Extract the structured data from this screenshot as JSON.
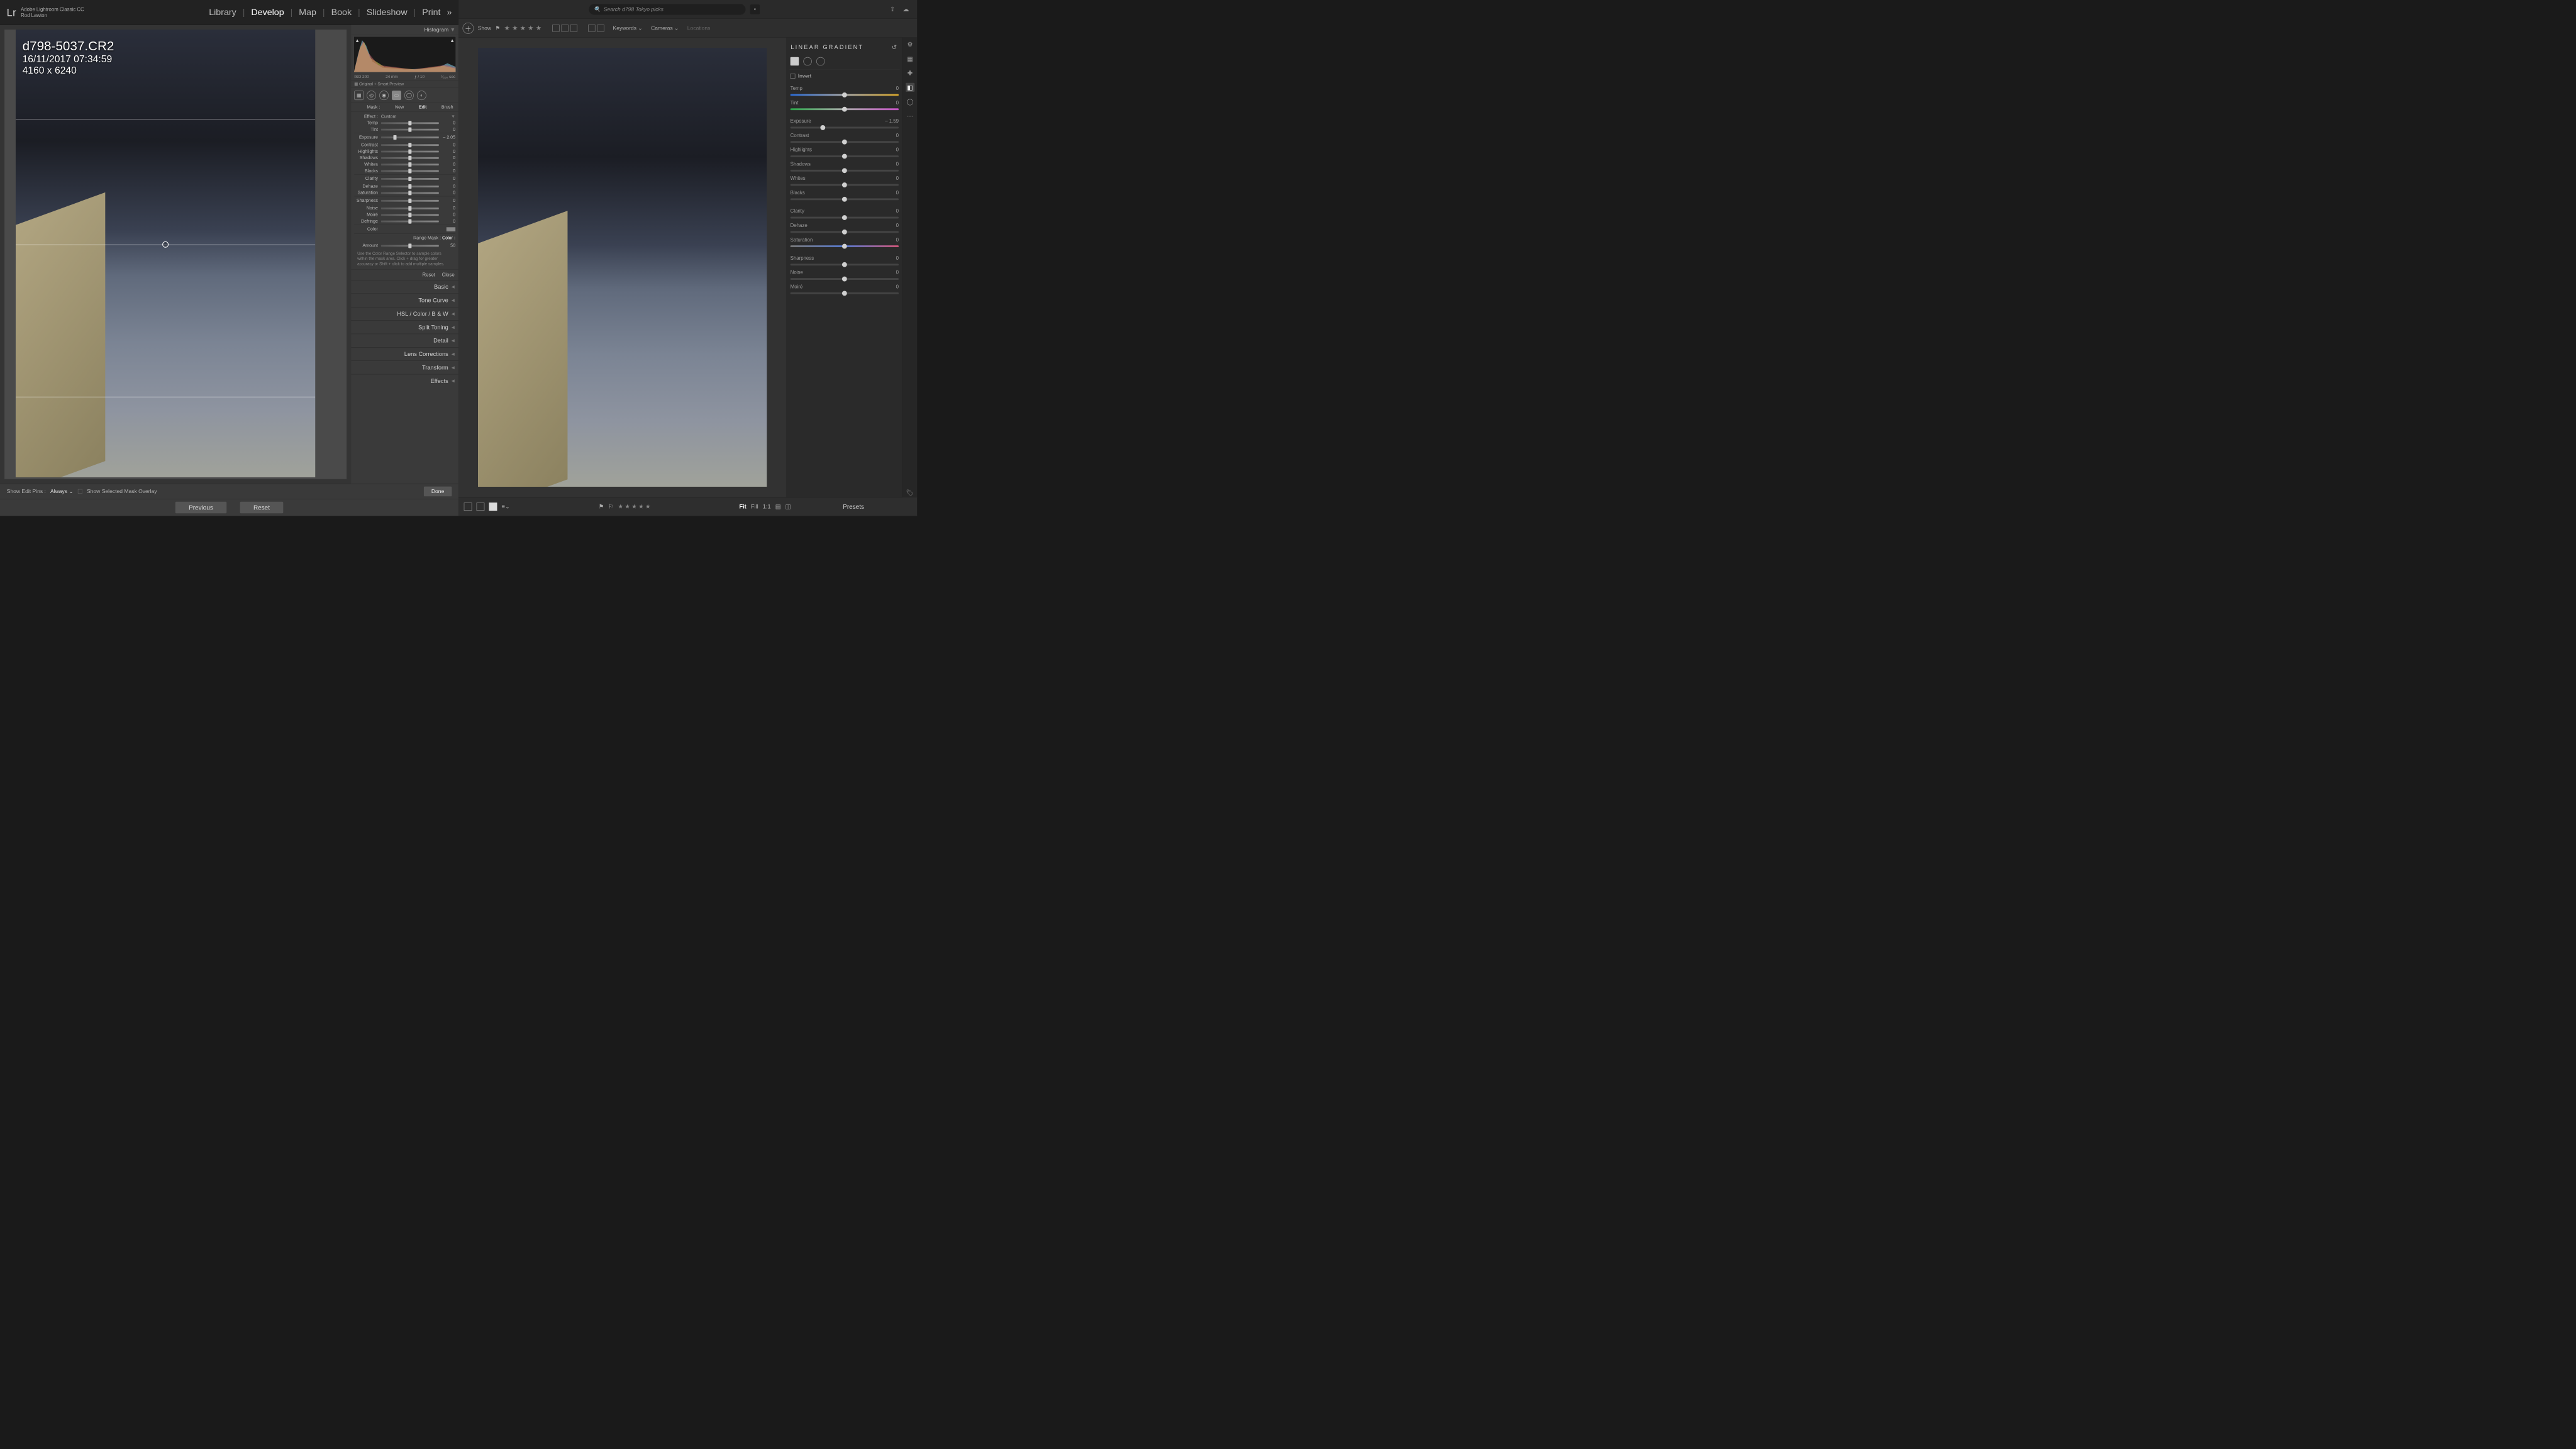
{
  "left": {
    "app_line1": "Adobe Lightroom Classic CC",
    "app_line2": "Rod Lawton",
    "logo": "Lr",
    "modules": [
      "Library",
      "Develop",
      "Map",
      "Book",
      "Slideshow",
      "Print"
    ],
    "active_module": "Develop",
    "more": "»",
    "overlay": {
      "filename": "d798-5037.CR2",
      "datetime": "16/11/2017 07:34:59",
      "dims": "4160 x 6240"
    },
    "bottombar": {
      "show_edit_pins": "Show Edit Pins :",
      "pins_mode": "Always",
      "show_mask": "Show Selected Mask Overlay",
      "done": "Done"
    },
    "panel": {
      "histogram": "Histogram",
      "hist_info": {
        "iso": "ISO 200",
        "fl": "24 mm",
        "ap": "ƒ / 10",
        "ss": "¹⁄₂₅₀ sec"
      },
      "preview": "Original + Smart Preview",
      "mask_label": "Mask :",
      "mask_new": "New",
      "mask_edit": "Edit",
      "mask_brush": "Brush",
      "effect_label": "Effect :",
      "effect_value": "Custom",
      "sliders": [
        {
          "l": "Temp",
          "v": "0",
          "p": 50
        },
        {
          "l": "Tint",
          "v": "0",
          "p": 50
        },
        {
          "l": "Exposure",
          "v": "– 2.05",
          "p": 24
        },
        {
          "l": "Contrast",
          "v": "0",
          "p": 50
        },
        {
          "l": "Highlights",
          "v": "0",
          "p": 50
        },
        {
          "l": "Shadows",
          "v": "0",
          "p": 50
        },
        {
          "l": "Whites",
          "v": "0",
          "p": 50
        },
        {
          "l": "Blacks",
          "v": "0",
          "p": 50
        },
        {
          "l": "Clarity",
          "v": "0",
          "p": 50
        },
        {
          "l": "Dehaze",
          "v": "0",
          "p": 50
        },
        {
          "l": "Saturation",
          "v": "0",
          "p": 50
        },
        {
          "l": "Sharpness",
          "v": "0",
          "p": 50
        },
        {
          "l": "Noise",
          "v": "0",
          "p": 50
        },
        {
          "l": "Moiré",
          "v": "0",
          "p": 50
        },
        {
          "l": "Defringe",
          "v": "0",
          "p": 50
        }
      ],
      "color_label": "Color",
      "range_mask_label": "Range Mask :",
      "range_mask_value": "Color",
      "amount_label": "Amount",
      "amount_value": "50",
      "hint": "Use the Color Range Selector to sample colors within the mask area. Click + drag for greater accuracy or Shift + click to add multiple samples.",
      "reset": "Reset",
      "close": "Close",
      "panels": [
        "Basic",
        "Tone Curve",
        "HSL  /  Color  /  B & W",
        "Split Toning",
        "Detail",
        "Lens Corrections",
        "Transform",
        "Effects"
      ]
    },
    "footer": {
      "previous": "Previous",
      "reset": "Reset"
    }
  },
  "right": {
    "search_placeholder": "Search d798 Tokyo picks",
    "toolbar": {
      "show": "Show",
      "keywords": "Keywords",
      "cameras": "Cameras",
      "locations": "Locations"
    },
    "panel": {
      "title": "LINEAR GRADIENT",
      "invert": "Invert",
      "sliders": [
        {
          "l": "Temp",
          "v": "0",
          "p": 50,
          "c": "temp"
        },
        {
          "l": "Tint",
          "v": "0",
          "p": 50,
          "c": "tint"
        },
        {
          "l": "Exposure",
          "v": "– 1.59",
          "p": 30,
          "c": ""
        },
        {
          "l": "Contrast",
          "v": "0",
          "p": 50,
          "c": ""
        },
        {
          "l": "Highlights",
          "v": "0",
          "p": 50,
          "c": ""
        },
        {
          "l": "Shadows",
          "v": "0",
          "p": 50,
          "c": ""
        },
        {
          "l": "Whites",
          "v": "0",
          "p": 50,
          "c": ""
        },
        {
          "l": "Blacks",
          "v": "0",
          "p": 50,
          "c": ""
        },
        {
          "l": "Clarity",
          "v": "0",
          "p": 50,
          "c": ""
        },
        {
          "l": "Dehaze",
          "v": "0",
          "p": 50,
          "c": ""
        },
        {
          "l": "Saturation",
          "v": "0",
          "p": 50,
          "c": "sat"
        },
        {
          "l": "Sharpness",
          "v": "0",
          "p": 50,
          "c": ""
        },
        {
          "l": "Noise",
          "v": "0",
          "p": 50,
          "c": ""
        },
        {
          "l": "Moiré",
          "v": "0",
          "p": 50,
          "c": ""
        }
      ]
    },
    "footer": {
      "fit": "Fit",
      "fill": "Fill",
      "oneone": "1:1",
      "presets": "Presets"
    }
  }
}
